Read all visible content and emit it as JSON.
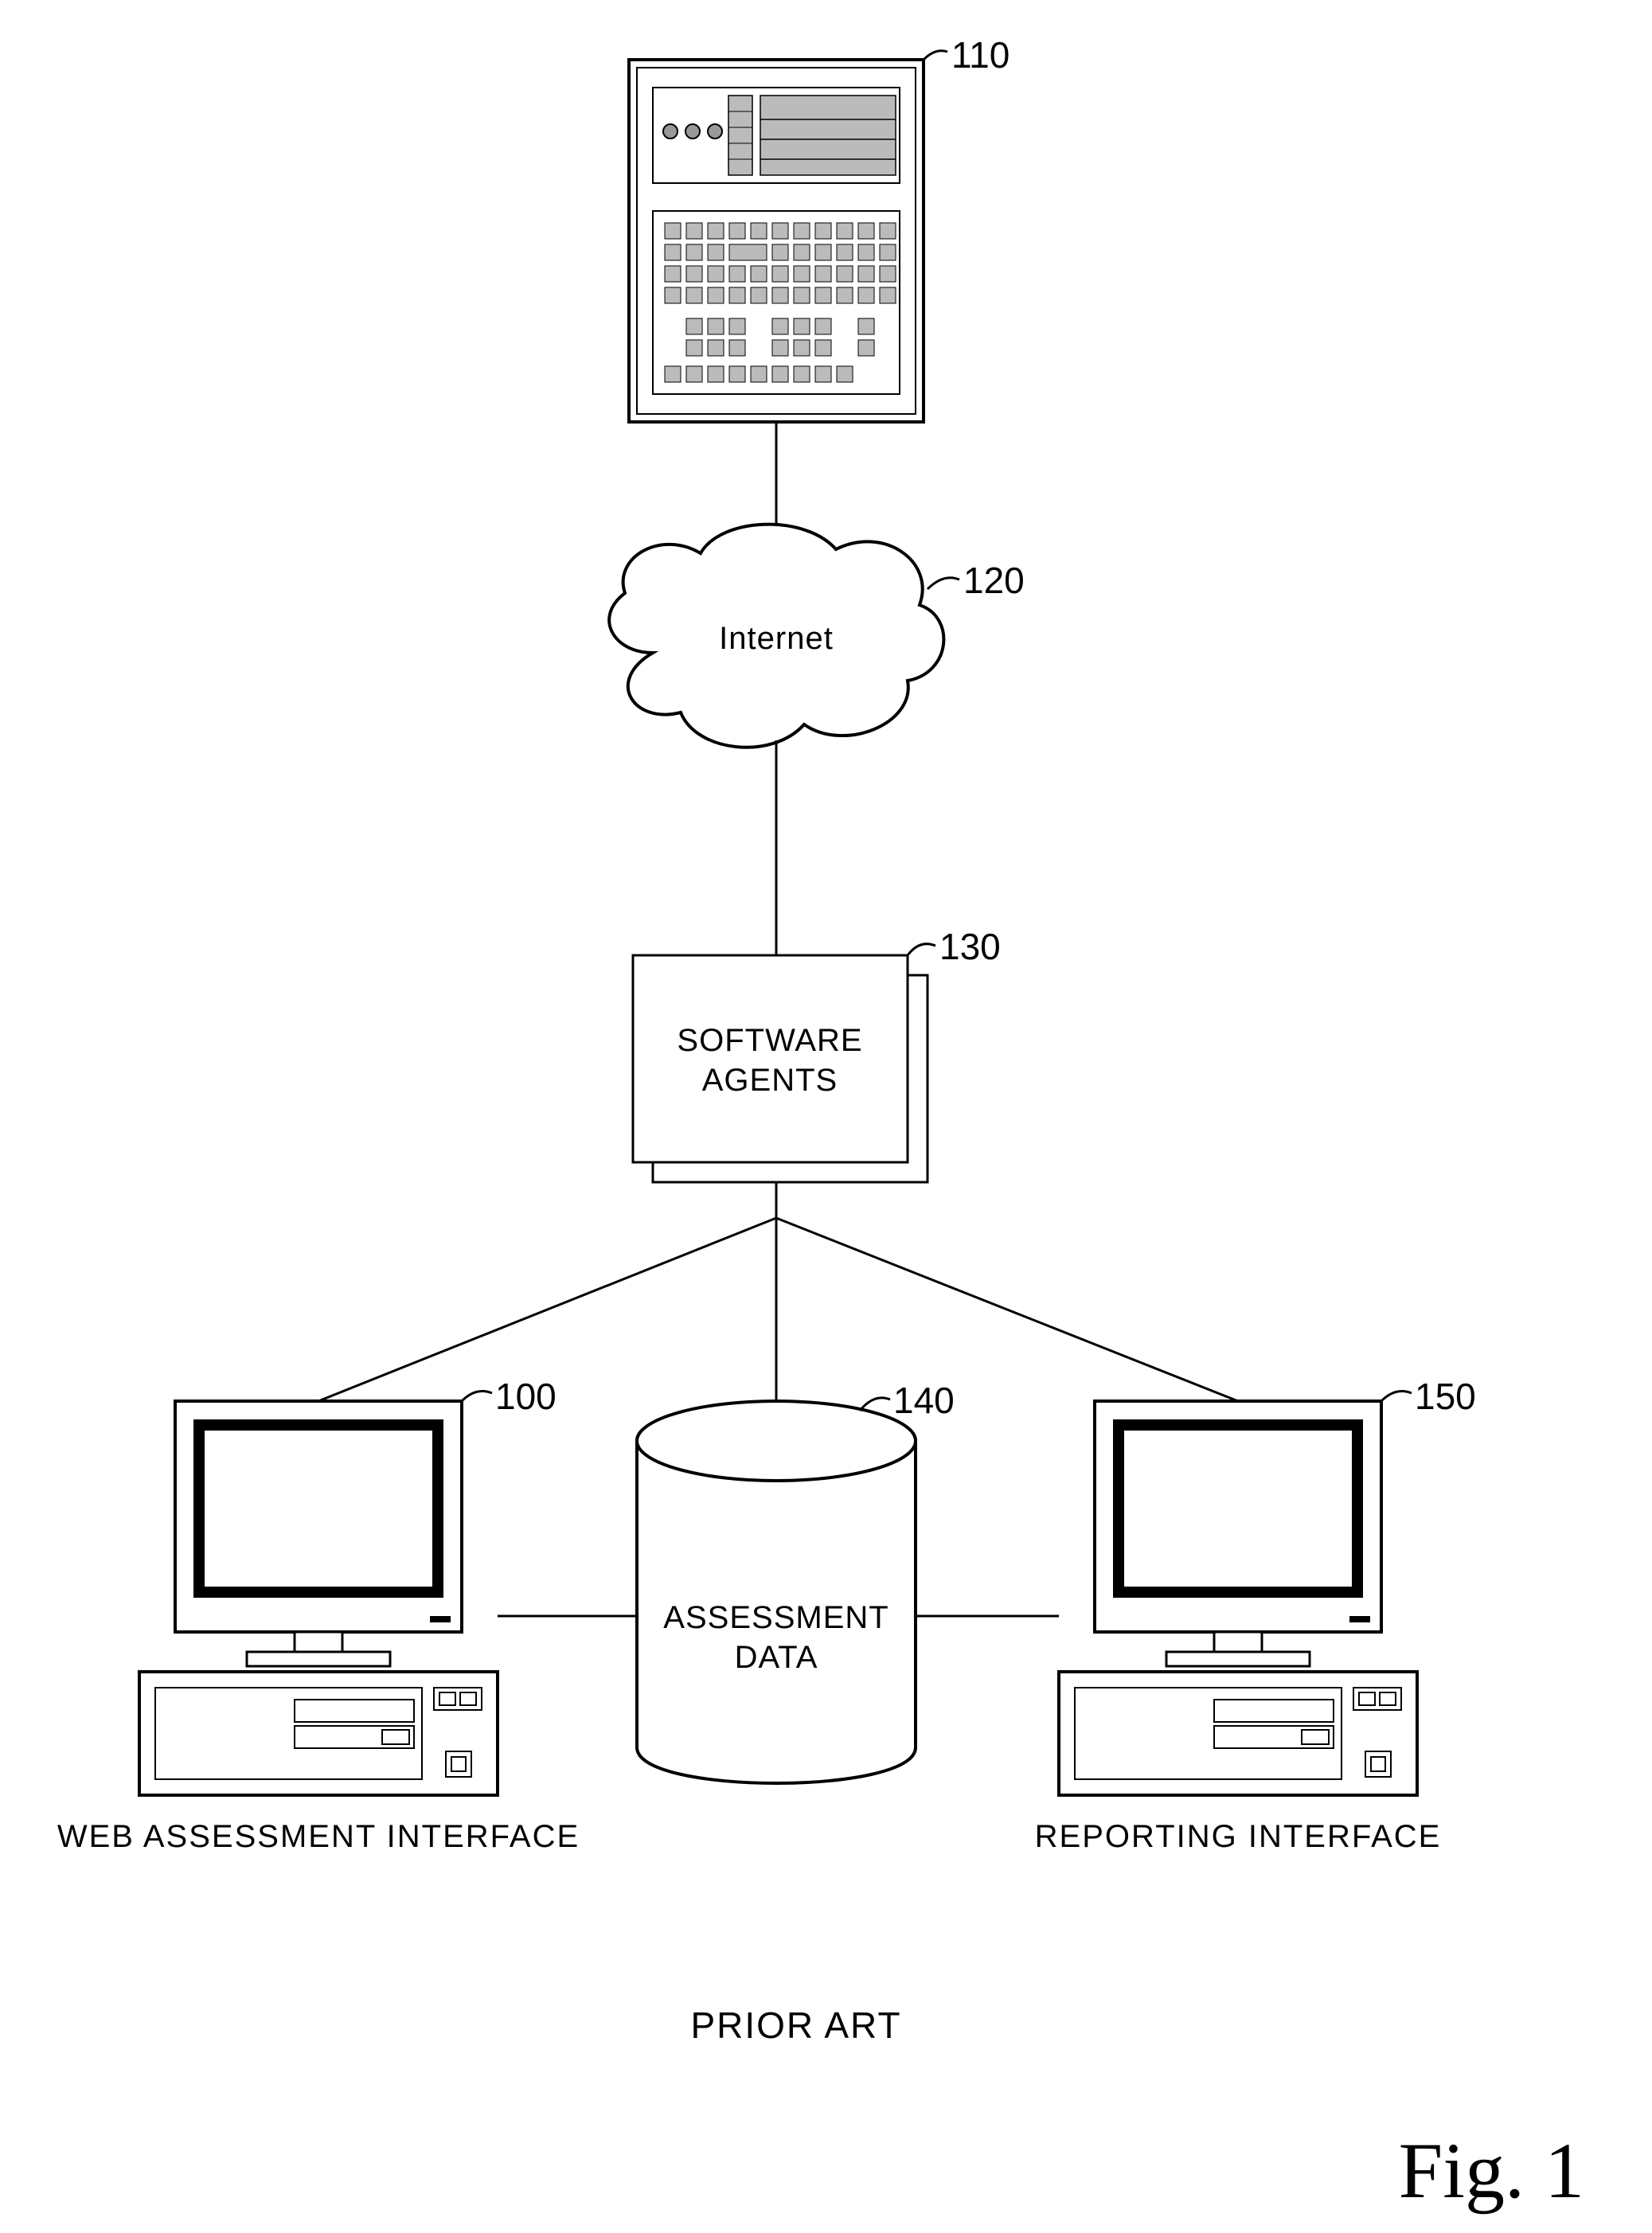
{
  "refs": {
    "server": "110",
    "internet": "120",
    "agents": "130",
    "left_pc": "100",
    "db": "140",
    "right_pc": "150"
  },
  "labels": {
    "internet": "Internet",
    "agents_l1": "SOFTWARE",
    "agents_l2": "AGENTS",
    "db_l1": "ASSESSMENT",
    "db_l2": "DATA",
    "left_caption": "WEB ASSESSMENT INTERFACE",
    "right_caption": "REPORTING INTERFACE",
    "prior_art": "PRIOR ART",
    "figure": "Fig. 1"
  }
}
